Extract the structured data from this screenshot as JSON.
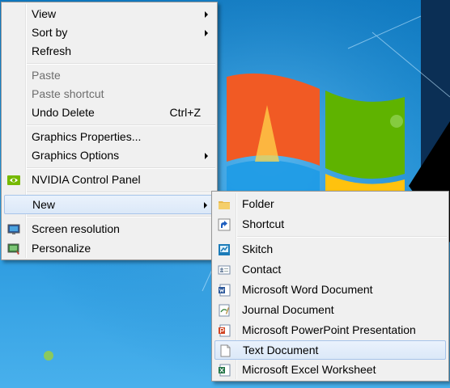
{
  "context_menu": {
    "view": "View",
    "sort_by": "Sort by",
    "refresh": "Refresh",
    "paste": "Paste",
    "paste_shortcut": "Paste shortcut",
    "undo_delete": "Undo Delete",
    "undo_shortcut": "Ctrl+Z",
    "graphics_properties": "Graphics Properties...",
    "graphics_options": "Graphics Options",
    "nvidia": "NVIDIA Control Panel",
    "new": "New",
    "screen_resolution": "Screen resolution",
    "personalize": "Personalize"
  },
  "new_submenu": {
    "folder": "Folder",
    "shortcut": "Shortcut",
    "skitch": "Skitch",
    "contact": "Contact",
    "word": "Microsoft Word Document",
    "journal": "Journal Document",
    "powerpoint": "Microsoft PowerPoint Presentation",
    "text": "Text Document",
    "excel": "Microsoft Excel Worksheet"
  },
  "icons": {
    "nvidia": "nvidia-icon",
    "screen_resolution": "monitor-icon",
    "personalize": "personalize-icon",
    "folder": "folder-icon",
    "shortcut": "shortcut-arrow-icon",
    "skitch": "skitch-icon",
    "contact": "contact-card-icon",
    "word": "word-document-icon",
    "journal": "journal-icon",
    "powerpoint": "powerpoint-icon",
    "text": "text-file-icon",
    "excel": "excel-icon"
  },
  "colors": {
    "menu_bg": "#f0f0f0",
    "highlight_border": "#a7c4ea",
    "desktop_blue": "#1a8ad0"
  }
}
